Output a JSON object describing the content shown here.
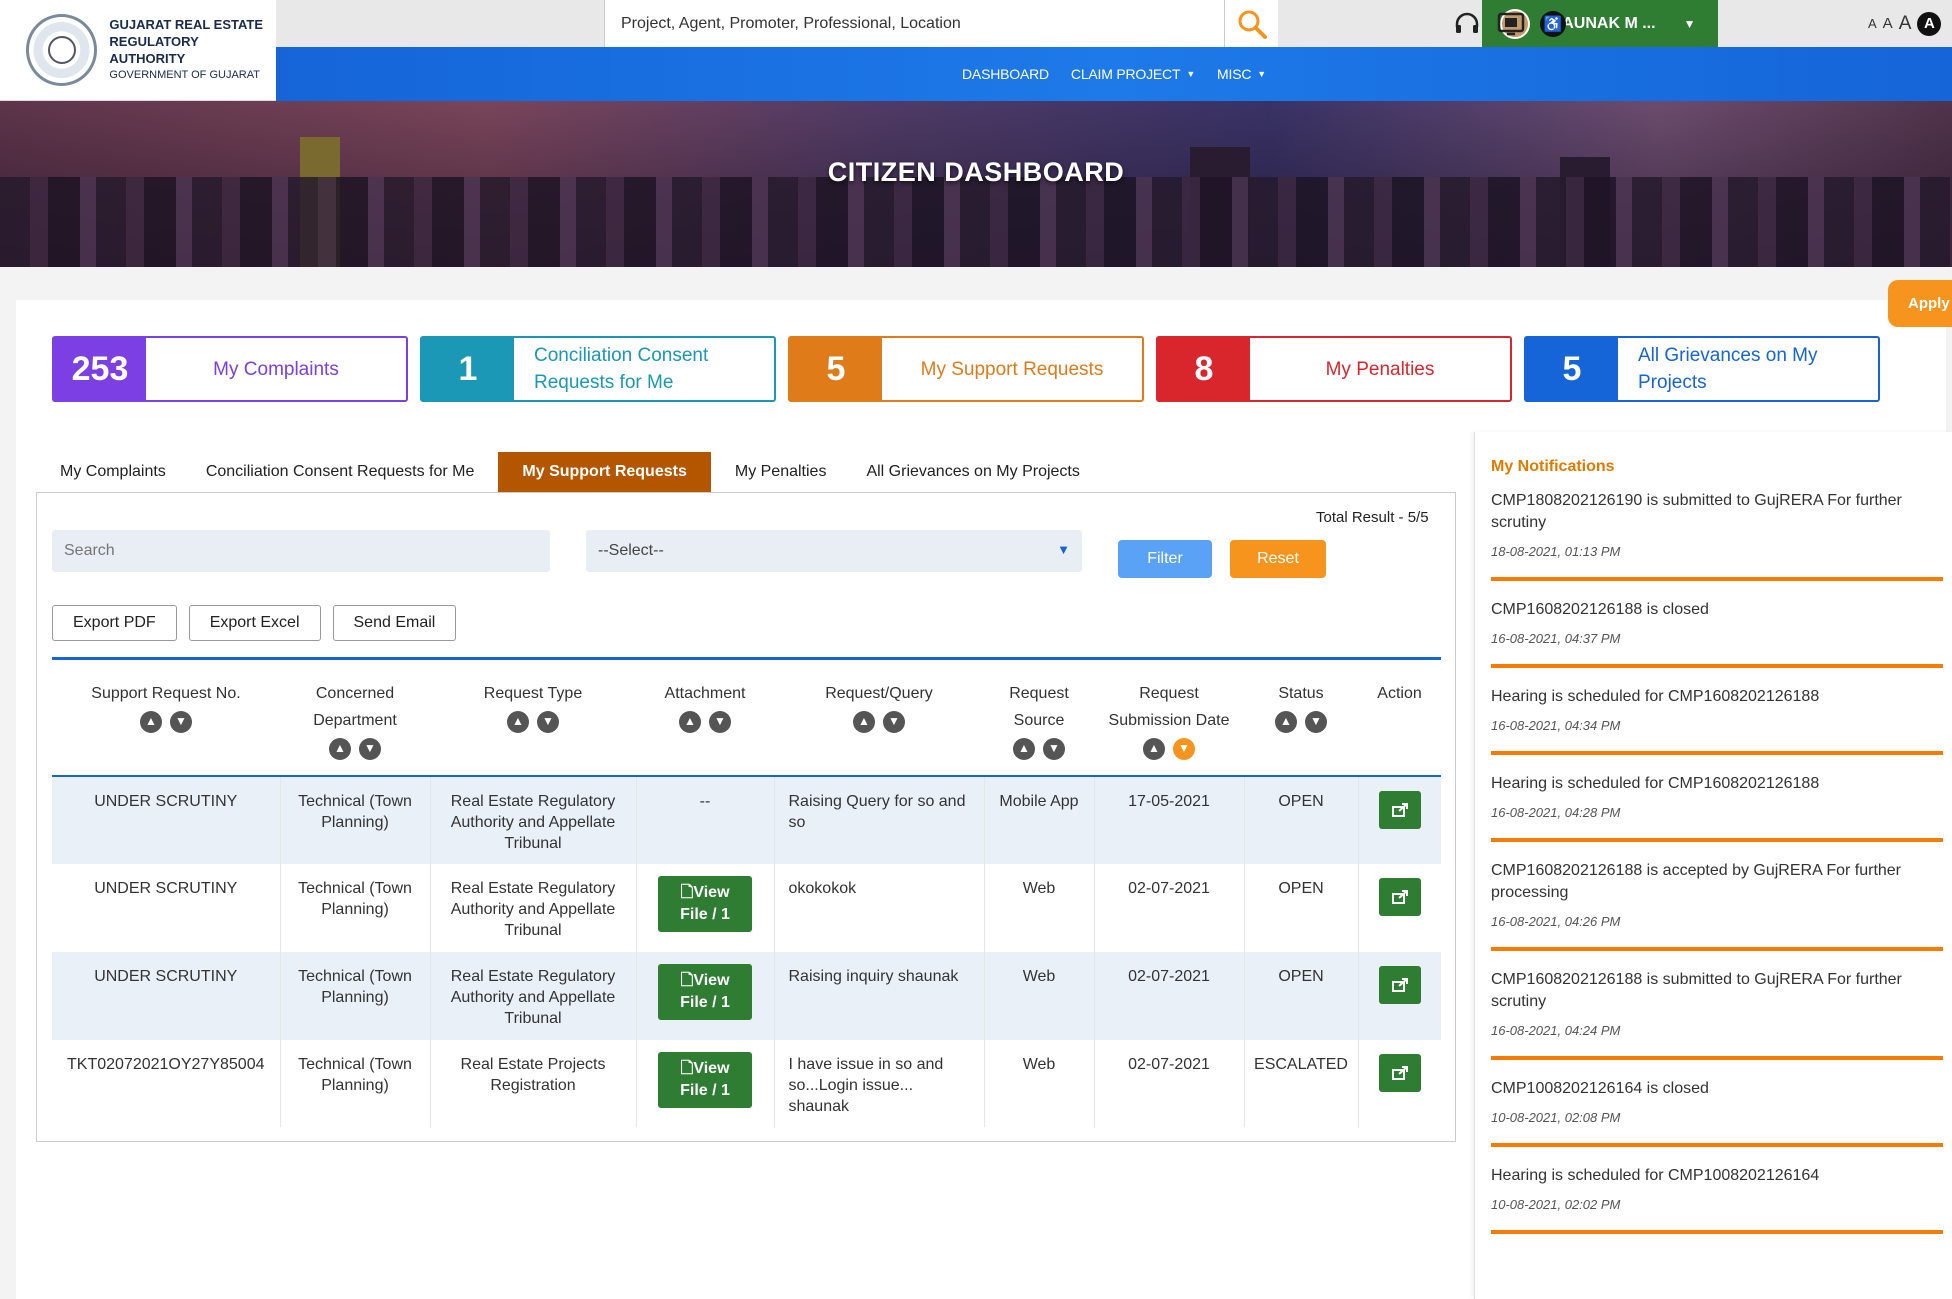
{
  "header": {
    "logo_line1": "GUJARAT REAL ESTATE",
    "logo_line2": "REGULATORY AUTHORITY",
    "logo_line3": "GOVERNMENT OF GUJARAT",
    "search_placeholder": "Project, Agent, Promoter, Professional, Location",
    "user_name": "SHAUNAK M ...",
    "font_small": "A",
    "font_medium": "A",
    "font_large": "A",
    "font_dark": "A"
  },
  "nav": {
    "items": [
      {
        "label": "DASHBOARD"
      },
      {
        "label": "CLAIM PROJECT"
      },
      {
        "label": "MISC"
      }
    ]
  },
  "banner": {
    "title": "CITIZEN DASHBOARD"
  },
  "apply_label": "Apply",
  "stats": [
    {
      "count": "253",
      "label": "My Complaints",
      "color": "#7b3fe4"
    },
    {
      "count": "1",
      "label": "Conciliation Consent Requests for Me",
      "color": "#1a98b5"
    },
    {
      "count": "5",
      "label": "My Support Requests",
      "color": "#e07b1a"
    },
    {
      "count": "8",
      "label": "My Penalties",
      "color": "#d9262c"
    },
    {
      "count": "5",
      "label": "All Grievances on My Projects",
      "color": "#1565d8"
    }
  ],
  "tabs": [
    {
      "label": "My Complaints"
    },
    {
      "label": "Conciliation Consent Requests for Me"
    },
    {
      "label": "My Support Requests"
    },
    {
      "label": "My Penalties"
    },
    {
      "label": "All Grievances on My Projects"
    }
  ],
  "filters": {
    "total_result": "Total Result - 5/5",
    "search_placeholder": "Search",
    "select_value": "--Select--",
    "filter_label": "Filter",
    "reset_label": "Reset"
  },
  "exports": {
    "pdf": "Export PDF",
    "excel": "Export Excel",
    "email": "Send Email"
  },
  "table": {
    "headers": [
      "Support Request No.",
      "Concerned Department",
      "Request Type",
      "Attachment",
      "Request/Query",
      "Request Source",
      "Request Submission Date",
      "Status",
      "Action"
    ],
    "view_line1": "View",
    "view_line2": "File / 1",
    "rows": [
      {
        "no": "UNDER SCRUTINY",
        "dept": "Technical (Town Planning)",
        "type": "Real Estate Regulatory Authority and Appellate Tribunal",
        "attachment": "--",
        "query": "Raising Query for so and so",
        "source": "Mobile App",
        "date": "17-05-2021",
        "status": "OPEN"
      },
      {
        "no": "UNDER SCRUTINY",
        "dept": "Technical (Town Planning)",
        "type": "Real Estate Regulatory Authority and Appellate Tribunal",
        "attachment": "view",
        "query": "okokokok",
        "source": "Web",
        "date": "02-07-2021",
        "status": "OPEN"
      },
      {
        "no": "UNDER SCRUTINY",
        "dept": "Technical (Town Planning)",
        "type": "Real Estate Regulatory Authority and Appellate Tribunal",
        "attachment": "view",
        "query": "Raising inquiry shaunak",
        "source": "Web",
        "date": "02-07-2021",
        "status": "OPEN"
      },
      {
        "no": "TKT02072021OY27Y85004",
        "dept": "Technical (Town Planning)",
        "type": "Real Estate Projects Registration",
        "attachment": "view",
        "query": "I have issue in so and so...Login issue... shaunak",
        "source": "Web",
        "date": "02-07-2021",
        "status": "ESCALATED"
      }
    ]
  },
  "notifications": {
    "title": "My Notifications",
    "items": [
      {
        "text": "CMP1808202126190 is submitted to GujRERA For further scrutiny",
        "date": "18-08-2021, 01:13 PM"
      },
      {
        "text": "CMP1608202126188 is closed",
        "date": "16-08-2021, 04:37 PM"
      },
      {
        "text": "Hearing is scheduled for CMP1608202126188",
        "date": "16-08-2021, 04:34 PM"
      },
      {
        "text": "Hearing is scheduled for CMP1608202126188",
        "date": "16-08-2021, 04:28 PM"
      },
      {
        "text": "CMP1608202126188 is accepted by GujRERA For further processing",
        "date": "16-08-2021, 04:26 PM"
      },
      {
        "text": "CMP1608202126188 is submitted to GujRERA For further scrutiny",
        "date": "16-08-2021, 04:24 PM"
      },
      {
        "text": "CMP1008202126164 is closed",
        "date": "10-08-2021, 02:08 PM"
      },
      {
        "text": "Hearing is scheduled for CMP1008202126164",
        "date": "10-08-2021, 02:02 PM"
      }
    ]
  }
}
